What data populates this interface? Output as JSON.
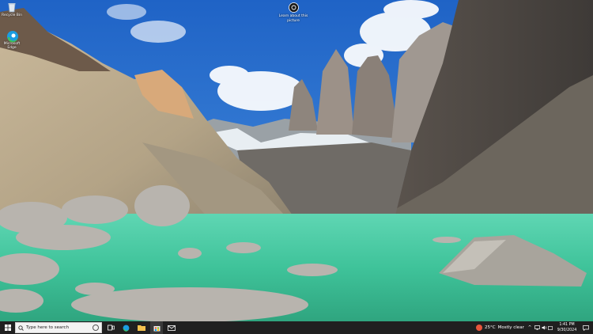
{
  "desktop": {
    "icons": [
      {
        "label": "Recycle Bin",
        "icon": "recycle-bin-icon"
      },
      {
        "label": "Microsoft Edge",
        "icon": "edge-icon"
      }
    ],
    "learn_about": {
      "label": "Learn about this picture",
      "icon": "camera-icon"
    }
  },
  "taskbar": {
    "start_icon": "windows-logo-icon",
    "search_placeholder": "Type here to search",
    "pinned": [
      {
        "name": "task-view",
        "icon": "task-view-icon"
      },
      {
        "name": "edge",
        "icon": "edge-icon"
      },
      {
        "name": "file-explorer",
        "icon": "folder-icon"
      },
      {
        "name": "store",
        "icon": "store-icon"
      },
      {
        "name": "mail",
        "icon": "mail-icon"
      }
    ],
    "weather": {
      "temp": "25°C",
      "condition": "Mostly clear"
    },
    "clock": {
      "time": "1:41 PM",
      "date": "9/30/2024"
    }
  }
}
